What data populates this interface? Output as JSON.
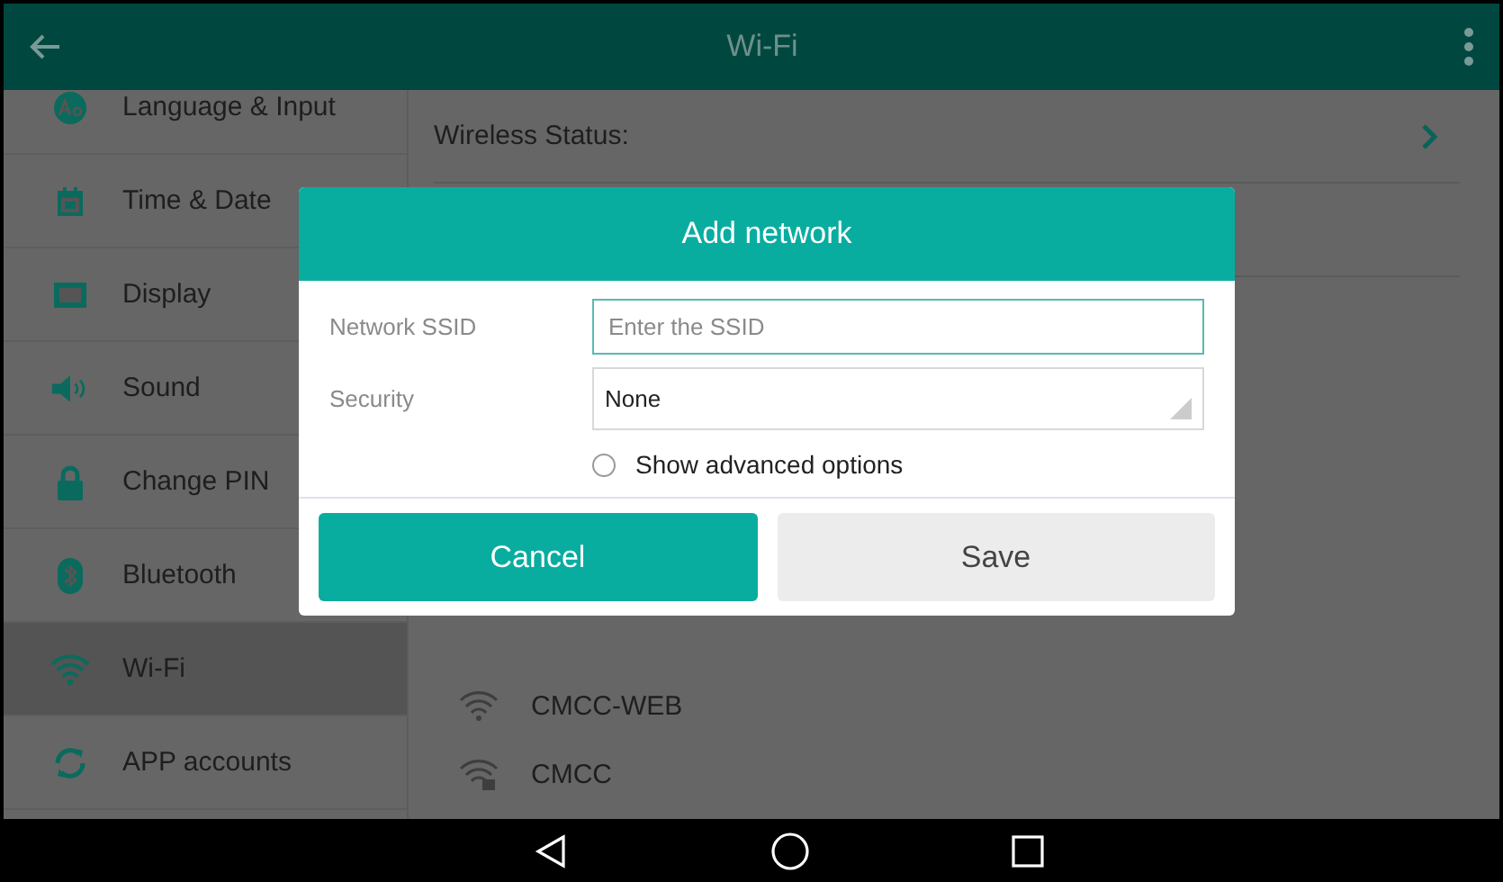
{
  "app_bar": {
    "title": "Wi-Fi"
  },
  "sidebar": {
    "items": [
      {
        "label": "Language & Input",
        "selected": false
      },
      {
        "label": "Time & Date",
        "selected": false
      },
      {
        "label": "Display",
        "selected": false
      },
      {
        "label": "Sound",
        "selected": false
      },
      {
        "label": "Change PIN",
        "selected": false
      },
      {
        "label": "Bluetooth",
        "selected": false
      },
      {
        "label": "Wi-Fi",
        "selected": true
      },
      {
        "label": "APP accounts",
        "selected": false
      }
    ]
  },
  "content": {
    "wireless_status": {
      "label": "Wireless Status:"
    },
    "networks": [
      {
        "name": "CMCC-WEB",
        "secured": false
      },
      {
        "name": "CMCC",
        "secured": true
      }
    ]
  },
  "dialog": {
    "title": "Add network",
    "fields": [
      {
        "label": "Network SSID",
        "kind": "text",
        "placeholder": "Enter the SSID",
        "focused": true
      },
      {
        "label": "Security",
        "kind": "select",
        "value": "None",
        "focused": false
      }
    ],
    "advanced": {
      "label": "Show advanced options",
      "checked": false
    },
    "buttons": [
      {
        "label": "Cancel",
        "primary": true
      },
      {
        "label": "Save",
        "primary": false
      }
    ]
  }
}
